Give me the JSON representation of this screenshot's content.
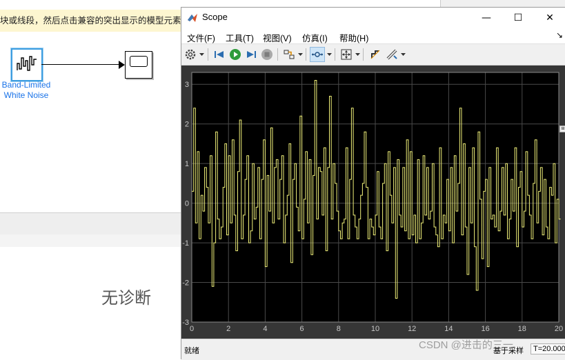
{
  "simulink": {
    "hint_text": "块或线段，然后点击兼容的突出显示的模型元素",
    "source_block_label_line1": "Band-Limited",
    "source_block_label_line2": "White Noise",
    "diagnostics_text": "无诊断"
  },
  "scope": {
    "title": "Scope",
    "window_controls": {
      "minimize": "—",
      "maximize": "☐",
      "close": "✕"
    },
    "menu": [
      "文件(F)",
      "工具(T)",
      "视图(V)",
      "仿真(I)",
      "帮助(H)"
    ],
    "toolbar_icons": [
      "gear-icon",
      "step-back-icon",
      "run-icon",
      "step-forward-icon",
      "stop-icon",
      "highlight-icon",
      "zoom-icon",
      "autoscale-icon",
      "cursor-icon",
      "measure-icon"
    ],
    "status": {
      "left": "就绪",
      "mid": "基于采样",
      "time": "T=20.000"
    },
    "colors": {
      "plot_bg": "#000000",
      "frame_bg": "#363636",
      "signal": "#f2f27a",
      "grid": "#4a4a4a",
      "tick_text": "#c8c8c8"
    }
  },
  "chart_data": {
    "type": "line",
    "title": "",
    "xlabel": "",
    "ylabel": "",
    "xlim": [
      0,
      20
    ],
    "ylim": [
      -3,
      3.3
    ],
    "xticks": [
      0,
      2,
      4,
      6,
      8,
      10,
      12,
      14,
      16,
      18,
      20
    ],
    "yticks": [
      -3,
      -2,
      -1,
      0,
      1,
      2,
      3
    ],
    "grid": true,
    "step_interpolation": true,
    "series": [
      {
        "dt": 0.1,
        "values": [
          0.3,
          2.4,
          -0.5,
          1.3,
          -0.9,
          0.2,
          -0.2,
          0.9,
          0.4,
          -0.5,
          1.2,
          -2.1,
          -1.0,
          1.8,
          -0.4,
          -0.9,
          -0.6,
          0.4,
          1.5,
          -0.8,
          1.2,
          -0.5,
          1.6,
          -0.3,
          -1.2,
          0.8,
          2.1,
          -0.9,
          -0.3,
          0.6,
          1.2,
          -1.0,
          -0.7,
          1.0,
          -0.4,
          -0.1,
          0.9,
          -0.9,
          0.6,
          1.6,
          -1.6,
          0.7,
          -0.2,
          1.9,
          -0.5,
          0.9,
          1.1,
          -0.4,
          0.6,
          1.2,
          -1.0,
          -0.3,
          0.2,
          1.5,
          -1.5,
          0.6,
          1.0,
          -0.1,
          -0.7,
          2.2,
          -0.9,
          0.1,
          1.3,
          -0.5,
          1.1,
          -1.3,
          0.7,
          3.1,
          -0.4,
          0.9,
          0.8,
          -0.3,
          1.4,
          -1.2,
          0.9,
          2.7,
          -0.4,
          1.0,
          0.5,
          -0.2,
          -0.7,
          -0.9,
          -0.5,
          -0.4,
          1.4,
          -0.9,
          0.6,
          2.4,
          -0.3,
          -0.6,
          -0.9,
          -0.4,
          0.2,
          0.5,
          1.8,
          0.4,
          -0.9,
          -0.4,
          -0.6,
          -0.8,
          -0.3,
          0.8,
          -0.6,
          -0.9,
          0.5,
          1.0,
          -1.2,
          1.3,
          0.2,
          -0.5,
          0.9,
          -2.4,
          1.1,
          -0.3,
          -0.6,
          0.9,
          -0.7,
          1.6,
          -0.9,
          1.3,
          -0.8,
          -0.3,
          -1.0,
          1.1,
          -0.9,
          -0.5,
          1.2,
          -0.3,
          0.9,
          -0.4,
          -0.2,
          1.0,
          -0.6,
          -0.8,
          -1.1,
          1.4,
          -0.9,
          -0.3,
          -0.5,
          0.6,
          -0.7,
          0.9,
          -1.0,
          1.2,
          -0.2,
          0.5,
          2.4,
          -0.8,
          1.5,
          -0.6,
          -1.8,
          0.9,
          -0.5,
          1.4,
          -1.1,
          -2.2,
          1.8,
          0.1,
          -1.4,
          0.3,
          0.6,
          -1.6,
          0.9,
          -0.4,
          -0.3,
          -0.6,
          1.4,
          -0.7,
          -0.2,
          0.9,
          -0.3,
          1.0,
          -0.9,
          -0.4,
          0.6,
          -0.2,
          1.4,
          -1.1,
          0.4,
          0.8,
          -0.6,
          -0.2,
          1.3,
          0.2,
          -0.3,
          -0.9,
          0.5,
          1.6,
          -0.5,
          0.3,
          0.9,
          -0.8,
          0.6,
          -0.6,
          -0.9,
          0.4,
          0.2,
          1.0,
          -1.0,
          0.1,
          -0.4
        ]
      }
    ]
  }
}
